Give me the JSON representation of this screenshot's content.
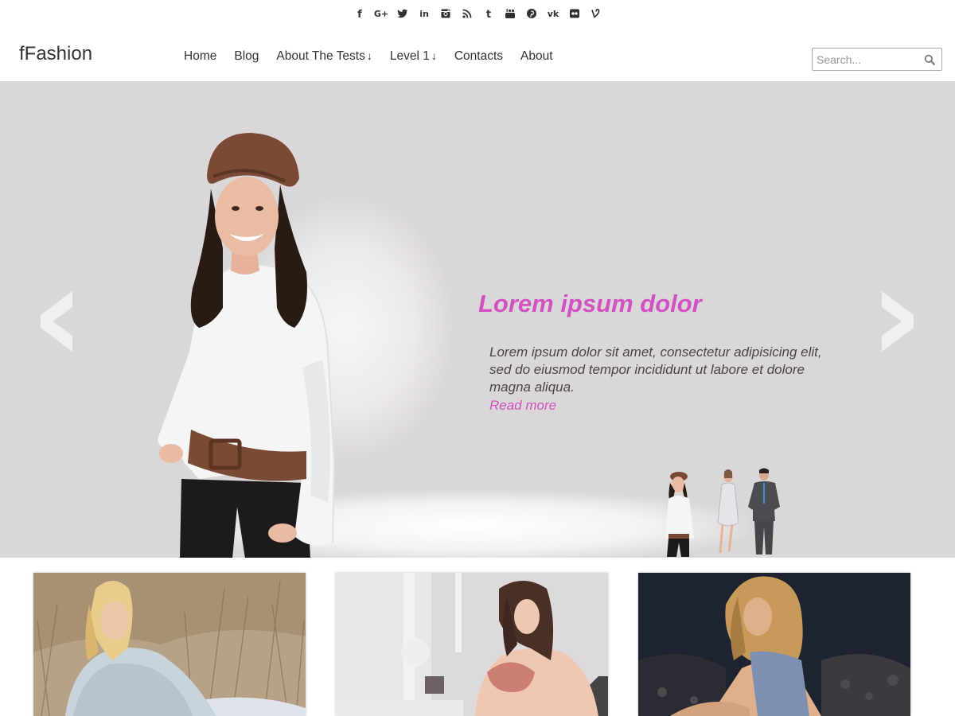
{
  "social": {
    "icons": [
      "facebook-icon",
      "google-plus-icon",
      "twitter-icon",
      "linkedin-icon",
      "instagram-icon",
      "rss-icon",
      "tumblr-icon",
      "youtube-icon",
      "pinterest-icon",
      "vk-icon",
      "flickr-icon",
      "vine-icon"
    ],
    "glyphs": {
      "facebook": "f",
      "google_plus": "G+",
      "linkedin": "in",
      "tumblr": "t",
      "vk": "vk"
    }
  },
  "header": {
    "site_title": "fFashion",
    "nav": [
      {
        "label": "Home"
      },
      {
        "label": "Blog"
      },
      {
        "label": "About The Tests",
        "arrow": "↓"
      },
      {
        "label": "Level 1",
        "arrow": "↓"
      },
      {
        "label": "Contacts"
      },
      {
        "label": "About"
      }
    ],
    "search": {
      "placeholder": "Search...",
      "value": ""
    }
  },
  "slider": {
    "title": "Lorem ipsum dolor",
    "text": "Lorem ipsum dolor sit amet, consectetur adipisicing elit, sed do eiusmod tempor incididunt ut labore et dolore magna aliqua.",
    "read_more": "Read more",
    "prev_icon": "chevron-left-icon",
    "next_icon": "chevron-right-icon"
  },
  "colors": {
    "accent": "#d152c0",
    "slider_bg": "#dad7d9",
    "text": "#333333"
  }
}
